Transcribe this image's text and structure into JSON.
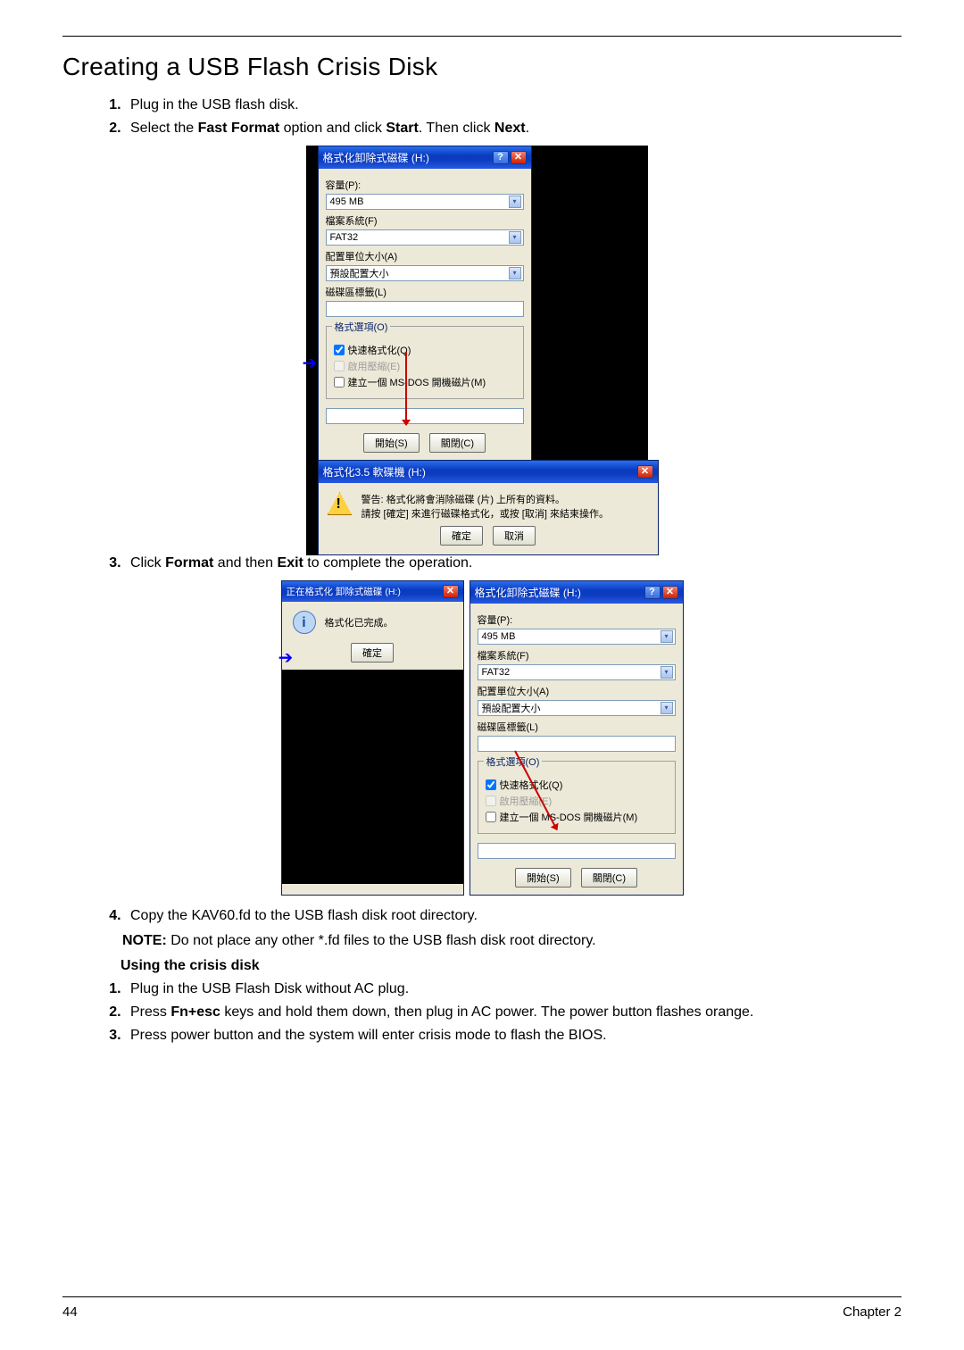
{
  "title": "Creating a USB Flash Crisis Disk",
  "steps_a": [
    "Plug in the USB flash disk.",
    {
      "pre": "Select the ",
      "b1": "Fast Format",
      "mid": " option and click ",
      "b2": "Start",
      "mid2": ". Then click ",
      "b3": "Next",
      "post": "."
    }
  ],
  "dialog1": {
    "title": "格式化卸除式磁碟 (H:)",
    "help": "?",
    "close": "✕",
    "capacity_label": "容量(P):",
    "capacity_value": "495 MB",
    "fs_label": "檔案系統(F)",
    "fs_value": "FAT32",
    "alloc_label": "配置單位大小(A)",
    "alloc_value": "預設配置大小",
    "vol_label": "磁碟區標籤(L)",
    "options_legend": "格式選項(O)",
    "cb_quick": "快速格式化(Q)",
    "cb_compress": "啟用壓縮(E)",
    "cb_msdos": "建立一個 MS-DOS 開機磁片(M)",
    "btn_start": "開始(S)",
    "btn_close": "關閉(C)"
  },
  "warning": {
    "title": "格式化3.5 軟碟機 (H:)",
    "line1": "警告: 格式化將會消除磁碟 (片) 上所有的資料。",
    "line2": "請按 [確定] 來進行磁碟格式化，或按 [取消] 來結束操作。",
    "ok": "確定",
    "cancel": "取消"
  },
  "step3": {
    "pre": "Click ",
    "b1": "Format",
    "mid": " and then ",
    "b2": "Exit",
    "post": " to complete the operation."
  },
  "complete": {
    "title": "正在格式化 卸除式磁碟 (H:)",
    "msg": "格式化已完成。",
    "ok": "確定"
  },
  "dialog2": {
    "title": "格式化卸除式磁碟 (H:)"
  },
  "step4": "Copy the KAV60.fd to the USB flash disk root directory.",
  "note_label": "NOTE:",
  "note_text": " Do not place any other *.fd files to the USB flash disk root directory.",
  "subheading": "Using the crisis disk",
  "steps_b": [
    "Plug in the USB Flash Disk without AC plug.",
    {
      "pre": "Press ",
      "b1": "Fn+esc",
      "post": " keys and hold them down, then plug in AC power. The power button flashes orange."
    },
    "Press power button and the system will enter crisis mode to flash the BIOS."
  ],
  "footer": {
    "page": "44",
    "chapter": "Chapter 2"
  }
}
